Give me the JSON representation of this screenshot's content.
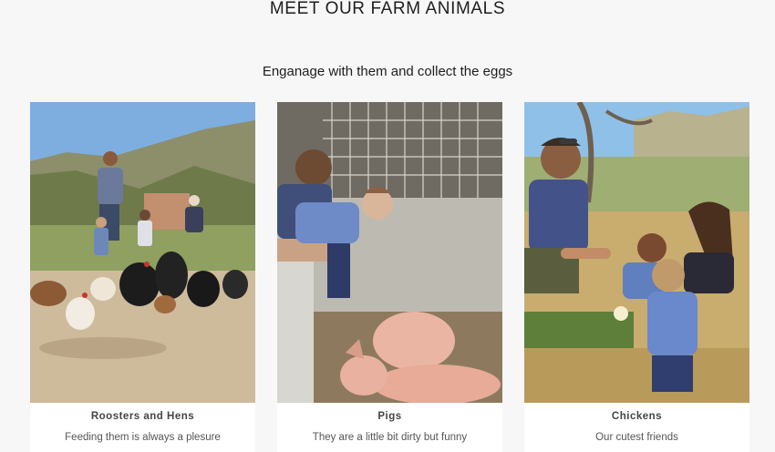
{
  "section": {
    "title": "MEET OUR FARM ANIMALS",
    "subtitle": "Enganage with them and collect the eggs"
  },
  "cards": [
    {
      "image_subject": "roosters-hens-photo",
      "title": "Roosters and Hens",
      "description": "Feeding them is always a plesure"
    },
    {
      "image_subject": "pigs-photo",
      "title": "Pigs",
      "description": "They are a little bit dirty but funny"
    },
    {
      "image_subject": "chickens-photo",
      "title": "Chickens",
      "description": "Our cutest friends"
    }
  ],
  "colors": {
    "page_background": "#f7f7f7",
    "card_background": "#ffffff",
    "heading_text": "#1e1e1e",
    "card_text": "#555555"
  }
}
